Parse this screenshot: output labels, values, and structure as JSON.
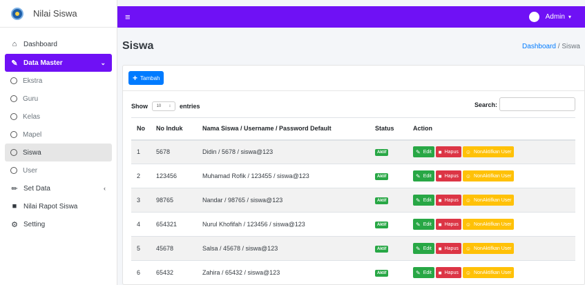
{
  "app": {
    "name": "Nilai Siswa"
  },
  "user": {
    "name": "Admin"
  },
  "sidebar": {
    "items": [
      {
        "label": "Dashboard"
      },
      {
        "label": "Data Master"
      },
      {
        "label": "Ekstra"
      },
      {
        "label": "Guru"
      },
      {
        "label": "Kelas"
      },
      {
        "label": "Mapel"
      },
      {
        "label": "Siswa"
      },
      {
        "label": "User"
      },
      {
        "label": "Set Data"
      },
      {
        "label": "Nilai Rapot Siswa"
      },
      {
        "label": "Setting"
      }
    ]
  },
  "page": {
    "title": "Siswa",
    "breadcrumb": {
      "home": "Dashboard",
      "separator": "/",
      "current": "Siswa"
    }
  },
  "toolbar": {
    "add_label": "Tambah"
  },
  "table_controls": {
    "show_label": "Show",
    "length_value": "10",
    "entries_label": "entries",
    "search_label": "Search:"
  },
  "table": {
    "headers": [
      "No",
      "No Induk",
      "Nama Siswa / Username / Password Default",
      "Status",
      "Action"
    ],
    "rows": [
      {
        "no": "1",
        "induk": "5678",
        "nama": "Didin / 5678 / siswa@123",
        "status": "Aktif"
      },
      {
        "no": "2",
        "induk": "123456",
        "nama": "Muhamad Rofik / 123455 / siswa@123",
        "status": "Aktif"
      },
      {
        "no": "3",
        "induk": "98765",
        "nama": "Nandar / 98765 / siswa@123",
        "status": "Aktif"
      },
      {
        "no": "4",
        "induk": "654321",
        "nama": "Nurul Khofifah / 123456 / siswa@123",
        "status": "Aktif"
      },
      {
        "no": "5",
        "induk": "45678",
        "nama": "Salsa / 45678 / siswa@123",
        "status": "Aktif"
      },
      {
        "no": "6",
        "induk": "65432",
        "nama": "Zahira / 65432 / siswa@123",
        "status": "Aktif"
      }
    ],
    "actions": {
      "edit": "Edit",
      "hapus": "Hapus",
      "nonaktif": "NonAktifkan User"
    }
  },
  "colors": {
    "primary": "#6f11f5",
    "add_button": "#007bff",
    "edit": "#28a745",
    "hapus": "#dc3545",
    "nonaktif": "#ffc107",
    "status_badge": "#28a745"
  }
}
